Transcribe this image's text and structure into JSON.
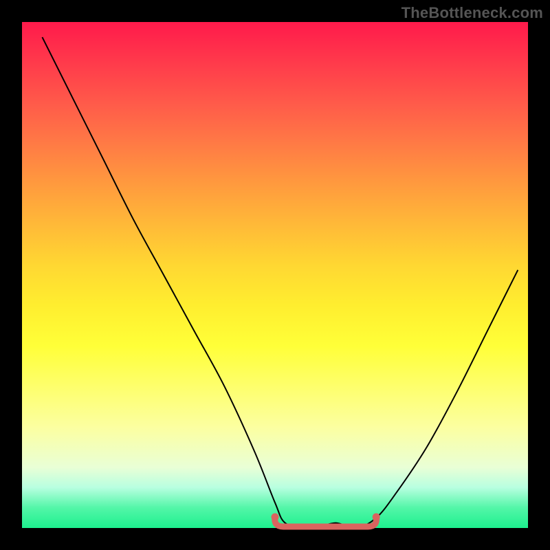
{
  "watermark": "TheBottleneck.com",
  "chart_data": {
    "type": "line",
    "title": "",
    "xlabel": "",
    "ylabel": "",
    "xlim": [
      0,
      100
    ],
    "ylim": [
      0,
      100
    ],
    "series": [
      {
        "name": "bottleneck-curve",
        "x": [
          4,
          10,
          16,
          22,
          28,
          34,
          40,
          46,
          50,
          52,
          56,
          58,
          62,
          66,
          70,
          74,
          80,
          86,
          92,
          98
        ],
        "y": [
          97,
          85,
          73,
          61,
          50,
          39,
          28,
          15,
          5,
          1,
          0,
          0,
          1,
          0,
          2,
          7,
          16,
          27,
          39,
          51
        ]
      }
    ],
    "highlight": {
      "name": "zero-bottleneck-band",
      "x_range": [
        50,
        70
      ],
      "y": 0
    },
    "background_gradient": {
      "top": "#ff1a4b",
      "mid": "#ffff38",
      "bottom": "#1df08e"
    }
  }
}
